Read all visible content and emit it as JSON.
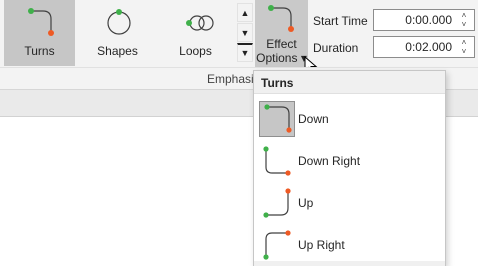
{
  "ribbon": {
    "gallery": [
      {
        "label": "Turns",
        "icon": "turns-path-icon",
        "selected": true
      },
      {
        "label": "Shapes",
        "icon": "shapes-path-icon",
        "selected": false
      },
      {
        "label": "Loops",
        "icon": "loops-path-icon",
        "selected": false
      }
    ],
    "scroll": {
      "up": "▲",
      "down": "▼",
      "more": "▼"
    },
    "effect_options": {
      "line1": "Effect",
      "line2": "Options",
      "caret": "▾"
    },
    "timing": {
      "start_time_label": "Start Time",
      "start_time_value": "0:00.000",
      "duration_label": "Duration",
      "duration_value": "0:02.000",
      "spin_up": "˄",
      "spin_down": "˅"
    },
    "group_label": "Emphasis"
  },
  "dropdown": {
    "header": "Turns",
    "items": [
      {
        "label": "Down",
        "icon": "turn-down-icon",
        "selected": true
      },
      {
        "label": "Down Right",
        "icon": "turn-down-right-icon",
        "selected": false
      },
      {
        "label": "Up",
        "icon": "turn-up-icon",
        "selected": false
      },
      {
        "label": "Up Right",
        "icon": "turn-up-right-icon",
        "selected": false
      }
    ]
  },
  "colors": {
    "start_dot": "#3fb04a",
    "end_dot": "#ee5a24",
    "path": "#404040"
  }
}
